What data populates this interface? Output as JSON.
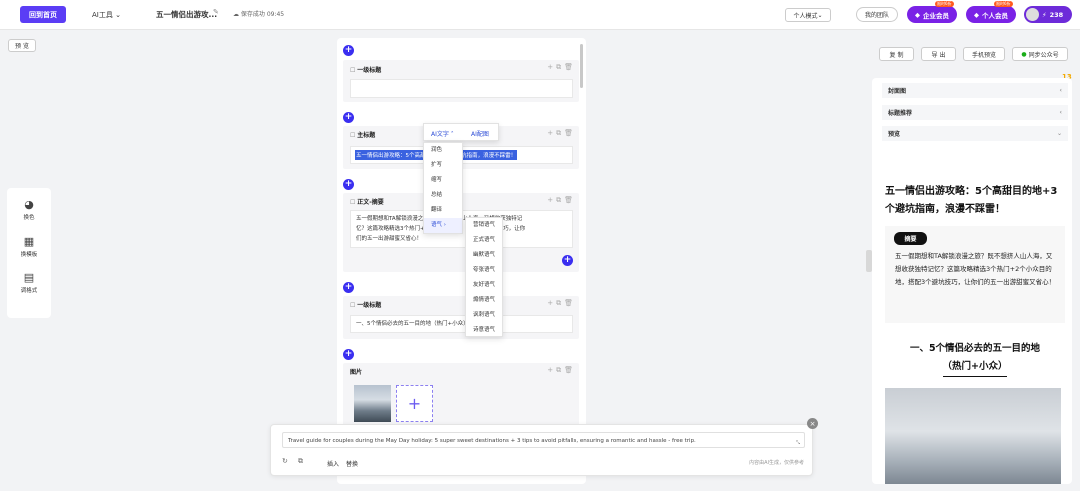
{
  "topbar": {
    "home_label": "回到首页",
    "ai_tools_label": "AI工具",
    "doc_title": "五一情侣出游攻...",
    "save_status": "保存成功 09:45",
    "mode_select": "个人模式",
    "team_label": "我的团队",
    "enterprise_label": "企业会员",
    "enterprise_badge": "限时6折",
    "personal_label": "个人会员",
    "personal_badge": "限时6折",
    "points": "238"
  },
  "left": {
    "preview_label": "预 览",
    "tools": [
      "换色",
      "换模板",
      "调格式"
    ]
  },
  "editor": {
    "sections": [
      {
        "header": "一级标题",
        "content": ""
      },
      {
        "header": "主标题",
        "content": "五一情侣出游攻略：5个高甜目的地+3个避坑指南，浪漫不踩雷！"
      },
      {
        "header": "正文-摘要",
        "line1": "五一假期想和TA解锁浪漫之旅？既不想挤人山人海，又想收获独特记",
        "line2": "忆？这篇攻略精选3个热门+2个小众目的地，搭配3个避坑技巧，让你",
        "line3": "们的五一出游甜蜜又省心！"
      },
      {
        "header": "一级标题",
        "content": "一、5个情侣必去的五一目的地（热门+小众）"
      },
      {
        "header": "图片"
      }
    ]
  },
  "ai_menu": {
    "tab_text": "AI文字",
    "tab_image": "AI配图",
    "items": [
      "润色",
      "扩写",
      "缩写",
      "总结",
      "翻译",
      "语气"
    ],
    "tone_items": [
      "营销语气",
      "正式语气",
      "幽默语气",
      "夸张语气",
      "友好语气",
      "煽情语气",
      "讽刺语气",
      "诗意语气"
    ]
  },
  "bottom_bar": {
    "output_text": "Travel guide for couples during the May Day holiday: 5 super sweet destinations + 3 tips to avoid pitfalls, ensuring a romantic and hassle - free trip.",
    "insert_label": "插入",
    "replace_label": "替换",
    "disclaimer": "内容由AI生成，仅供参考"
  },
  "right": {
    "copy_label": "复 制",
    "export_label": "导 出",
    "mobile_label": "手机预览",
    "sync_label": "同步公众号",
    "rows": [
      "封面图",
      "标题推荐",
      "预览"
    ],
    "preview_title": "五一情侣出游攻略：5个高甜目的地+3个避坑指南，浪漫不踩雷！",
    "summary_tag": "摘要",
    "summary_text": "五一假期想和TA解锁浪漫之旅？既不想挤人山人海，又想收获独特记忆？这篇攻略精选3个热门+2个小众目的地，搭配3个避坑技巧，让你们的五一出游甜蜜又省心！",
    "h1_line1": "一、5个情侣必去的五一目的地",
    "h1_line2": "（热门+小众）"
  },
  "colors": {
    "accent": "#3a2ef0",
    "brand": "#5b3df5",
    "member": "#7a22e6"
  }
}
